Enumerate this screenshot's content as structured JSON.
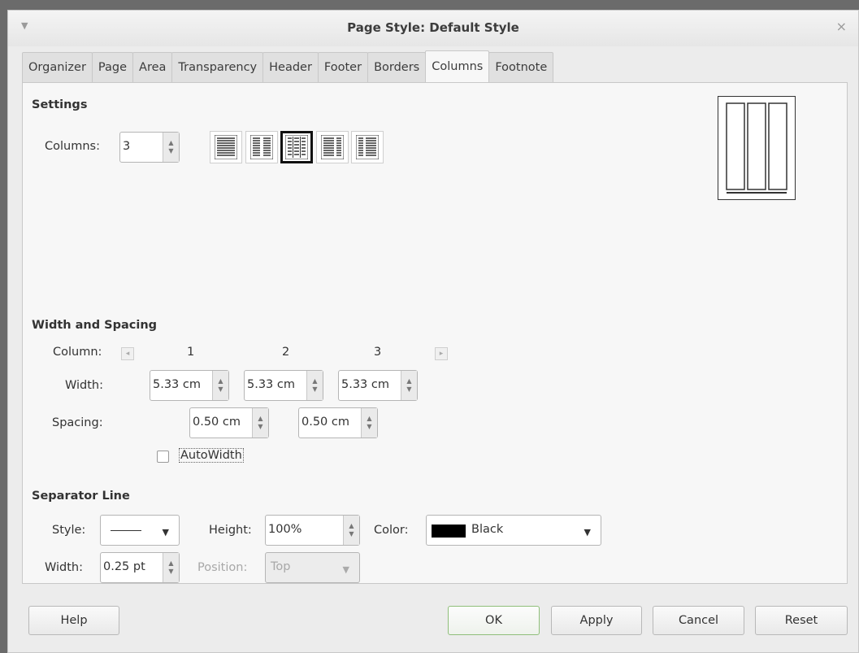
{
  "window": {
    "title": "Page Style: Default Style",
    "menu_glyph": "▼",
    "close_glyph": "×"
  },
  "tabs": [
    {
      "label": "Organizer"
    },
    {
      "label": "Page"
    },
    {
      "label": "Area"
    },
    {
      "label": "Transparency"
    },
    {
      "label": "Header"
    },
    {
      "label": "Footer"
    },
    {
      "label": "Borders"
    },
    {
      "label": "Columns"
    },
    {
      "label": "Footnote"
    }
  ],
  "active_tab": "Columns",
  "settings": {
    "title": "Settings",
    "columns_label": "Columns:",
    "columns_value": "3",
    "layout_presets": [
      "one-column",
      "two-columns",
      "three-columns",
      "two-columns-left-wide",
      "two-columns-right-wide"
    ],
    "selected_preset": "three-columns"
  },
  "width_spacing": {
    "title": "Width and Spacing",
    "column_label": "Column:",
    "column_numbers": [
      "1",
      "2",
      "3"
    ],
    "width_label": "Width:",
    "widths": [
      "5.33 cm",
      "5.33 cm",
      "5.33 cm"
    ],
    "spacing_label": "Spacing:",
    "spacings": [
      "0.50 cm",
      "0.50 cm"
    ],
    "autowidth_label": "AutoWidth",
    "autowidth_checked": false
  },
  "separator": {
    "title": "Separator Line",
    "style_label": "Style:",
    "height_label": "Height:",
    "height_value": "100%",
    "color_label": "Color:",
    "color_value": "Black",
    "color_hex": "#000000",
    "width_label": "Width:",
    "width_value": "0.25 pt",
    "position_label": "Position:",
    "position_value": "Top"
  },
  "buttons": {
    "help": "Help",
    "ok": "OK",
    "apply": "Apply",
    "cancel": "Cancel",
    "reset": "Reset"
  },
  "colors": {
    "window_bg": "#ececec",
    "panel_bg": "#f7f7f7",
    "default_button_border": "#8fbf7a"
  }
}
